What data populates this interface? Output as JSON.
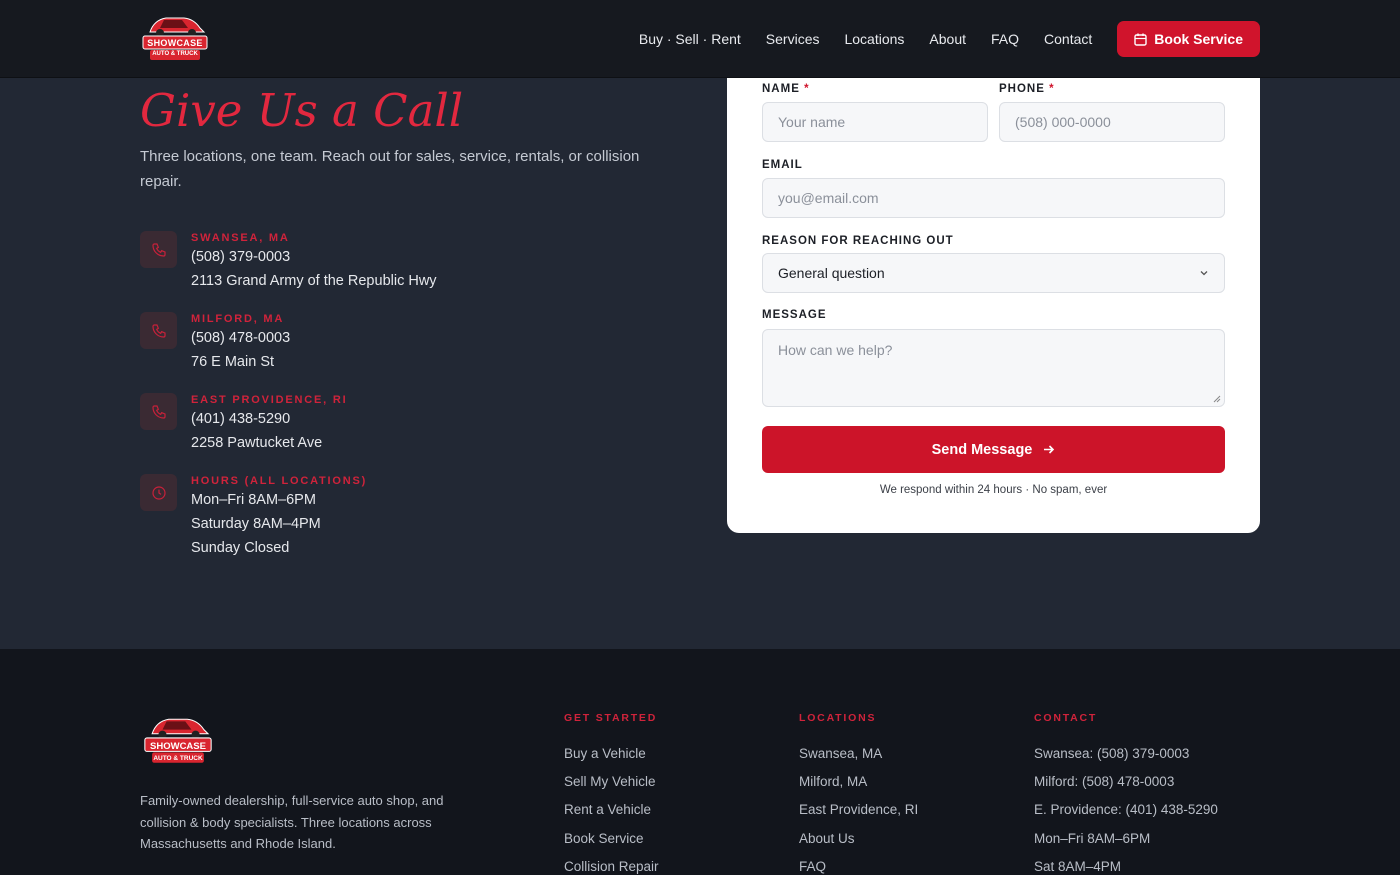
{
  "brand": {
    "logo_top": "SHOWCASE",
    "logo_bottom": "AUTO & TRUCK"
  },
  "nav": {
    "items": [
      "Buy · Sell · Rent",
      "Services",
      "Locations",
      "About",
      "FAQ",
      "Contact"
    ],
    "book_label": "Book Service"
  },
  "contact": {
    "heading": "Give Us a Call",
    "intro": "Three locations, one team. Reach out for sales, service, rentals, or collision repair.",
    "locations": [
      {
        "city": "Swansea, MA",
        "phone": "(508) 379-0003",
        "address": "2113 Grand Army of the Republic Hwy"
      },
      {
        "city": "Milford, MA",
        "phone": "(508) 478-0003",
        "address": "76 E Main St"
      },
      {
        "city": "East Providence, RI",
        "phone": "(401) 438-5290",
        "address": "2258 Pawtucket Ave"
      }
    ],
    "hours": {
      "title": "Hours (All Locations)",
      "lines": [
        "Mon–Fri 8AM–6PM",
        "Saturday 8AM–4PM",
        "Sunday Closed"
      ]
    }
  },
  "form": {
    "name_label": "NAME",
    "name_placeholder": "Your name",
    "phone_label": "PHONE",
    "phone_placeholder": "(508) 000-0000",
    "required_mark": "*",
    "email_label": "EMAIL",
    "email_placeholder": "you@email.com",
    "reason_label": "REASON FOR REACHING OUT",
    "reason_value": "General question",
    "message_label": "MESSAGE",
    "message_placeholder": "How can we help?",
    "send_label": "Send Message",
    "respond_note": "We respond within 24 hours · No spam, ever"
  },
  "footer": {
    "description": "Family-owned dealership, full-service auto shop, and collision & body specialists. Three locations across Massachusetts and Rhode Island.",
    "columns": [
      {
        "title": "Get Started",
        "links": [
          "Buy a Vehicle",
          "Sell My Vehicle",
          "Rent a Vehicle",
          "Book Service",
          "Collision Repair"
        ]
      },
      {
        "title": "Locations",
        "links": [
          "Swansea, MA",
          "Milford, MA",
          "East Providence, RI",
          "About Us",
          "FAQ"
        ]
      },
      {
        "title": "Contact",
        "links": [
          "Swansea: (508) 379-0003",
          "Milford: (508) 478-0003",
          "E. Providence: (401) 438-5290",
          "Mon–Fri 8AM–6PM",
          "Sat 8AM–4PM"
        ]
      }
    ]
  },
  "colors": {
    "accent": "#d0142c",
    "page_bg": "#222834",
    "header_bg": "#16191f",
    "footer_bg": "#12151c"
  },
  "icons": {
    "location": "phone-icon",
    "hours": "clock-icon",
    "book": "calendar-icon",
    "send": "arrow-right-icon",
    "select": "chevron-down-icon"
  }
}
